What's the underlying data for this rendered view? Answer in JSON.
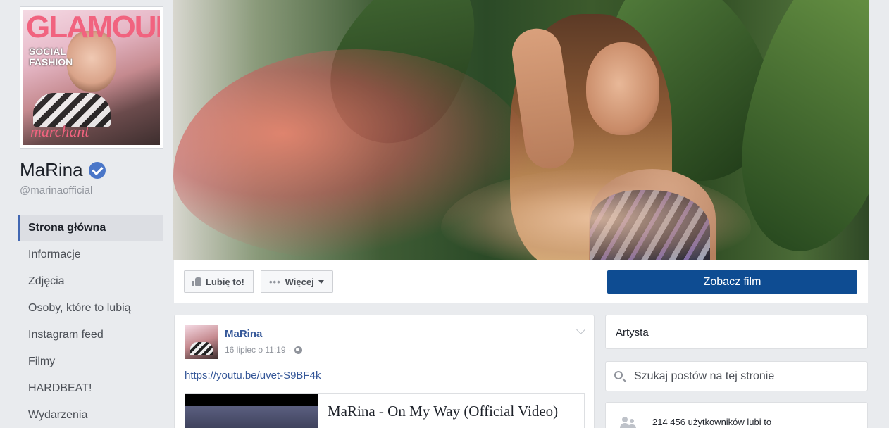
{
  "page": {
    "name": "MaRina",
    "handle": "@marinaofficial",
    "verified": true
  },
  "profile_picture": {
    "magazine_title": "GLAMOUR",
    "cover_lines": "SOCIAL\nFASHION",
    "bottom_line": "marchant"
  },
  "nav": {
    "items": [
      {
        "label": "Strona główna",
        "active": true
      },
      {
        "label": "Informacje",
        "active": false
      },
      {
        "label": "Zdjęcia",
        "active": false
      },
      {
        "label": "Osoby, które to lubią",
        "active": false
      },
      {
        "label": "Instagram feed",
        "active": false
      },
      {
        "label": "Filmy",
        "active": false
      },
      {
        "label": "HARDBEAT!",
        "active": false
      },
      {
        "label": "Wydarzenia",
        "active": false
      }
    ]
  },
  "actions": {
    "like_label": "Lubię to!",
    "more_label": "Więcej",
    "watch_label": "Zobacz film"
  },
  "post": {
    "author": "MaRina",
    "date": "16 lipiec o 11:19",
    "separator": "·",
    "link": "https://youtu.be/uvet-S9BF4k",
    "preview_title": "MaRina - On My Way (Official Video)"
  },
  "sidebar": {
    "category": "Artysta",
    "search_placeholder": "Szukaj postów na tej stronie",
    "likes_text": "214 456 użytkowników lubi to"
  },
  "colors": {
    "primary_button": "#0e4c92",
    "link": "#365899",
    "verified_badge": "#4a76c8",
    "background": "#e9ebee"
  }
}
